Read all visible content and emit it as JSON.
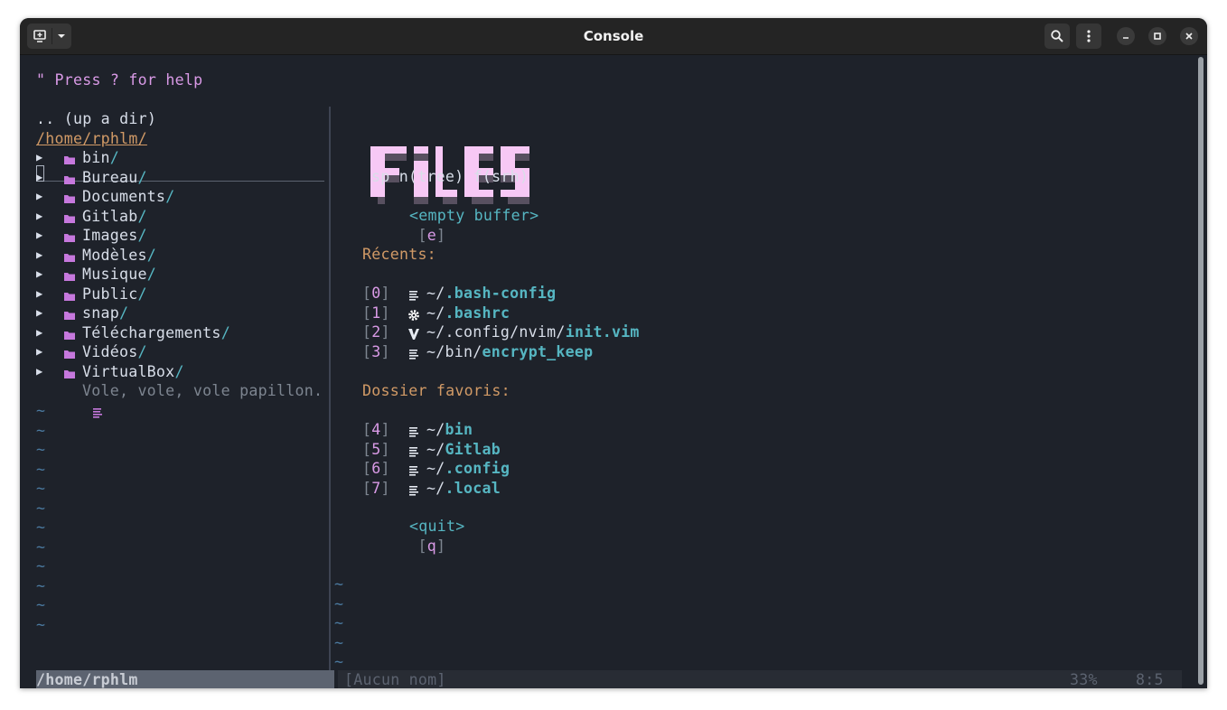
{
  "window": {
    "title": "Console"
  },
  "tree": {
    "help": "\" Press ? for help",
    "updir": ".. (up a dir)",
    "root": "/home/rphlm/",
    "arrow": "▶",
    "items": [
      {
        "name": "bin",
        "slash": "/"
      },
      {
        "name": "Bureau",
        "slash": "/"
      },
      {
        "name": "Documents",
        "slash": "/"
      },
      {
        "name": "Gitlab",
        "slash": "/"
      },
      {
        "name": "Images",
        "slash": "/"
      },
      {
        "name": "Modèles",
        "slash": "/"
      },
      {
        "name": "Musique",
        "slash": "/"
      },
      {
        "name": "Public",
        "slash": "/"
      },
      {
        "name": "snap",
        "slash": "/"
      },
      {
        "name": "Téléchargements",
        "slash": "/"
      },
      {
        "name": "Vidéos",
        "slash": "/"
      },
      {
        "name": "VirtualBox",
        "slash": "/"
      }
    ],
    "file": "Vole, vole, vole papillon.",
    "tilde": "~"
  },
  "startify": {
    "logo_caption": "sp n(tree) f(srh)",
    "empty": {
      "key": "[e]",
      "label": "<empty buffer>"
    },
    "recents_header": "Récents:",
    "recents": [
      {
        "key": "[0]",
        "icon": "text-file-icon",
        "prefix": "~/",
        "name": ".bash-config"
      },
      {
        "key": "[1]",
        "icon": "gear-icon",
        "prefix": "~/",
        "name": ".bashrc"
      },
      {
        "key": "[2]",
        "icon": "vim-icon",
        "prefix": "~/.config/nvim/",
        "name": "init.vim"
      },
      {
        "key": "[3]",
        "icon": "text-file-icon",
        "prefix": "~/bin/",
        "name": "encrypt_keep"
      }
    ],
    "bookmarks_header": "Dossier favoris:",
    "bookmarks": [
      {
        "key": "[4]",
        "icon": "text-file-icon",
        "prefix": "~/",
        "name": "bin"
      },
      {
        "key": "[5]",
        "icon": "text-file-icon",
        "prefix": "~/",
        "name": "Gitlab"
      },
      {
        "key": "[6]",
        "icon": "text-file-icon",
        "prefix": "~/",
        "name": ".config"
      },
      {
        "key": "[7]",
        "icon": "text-file-icon",
        "prefix": "~/",
        "name": ".local"
      }
    ],
    "quit": {
      "key": "[q]",
      "label": "<quit>"
    }
  },
  "statusline": {
    "left": "/home/rphlm",
    "buffer": "[Aucun nom]",
    "percent": "33%",
    "position": "8:5"
  },
  "colors": {
    "background": "#1e222a",
    "accent_pink": "#d99ae6",
    "accent_cyan": "#56b6c2",
    "accent_orange": "#d19a66",
    "folder": "#c678dd"
  }
}
